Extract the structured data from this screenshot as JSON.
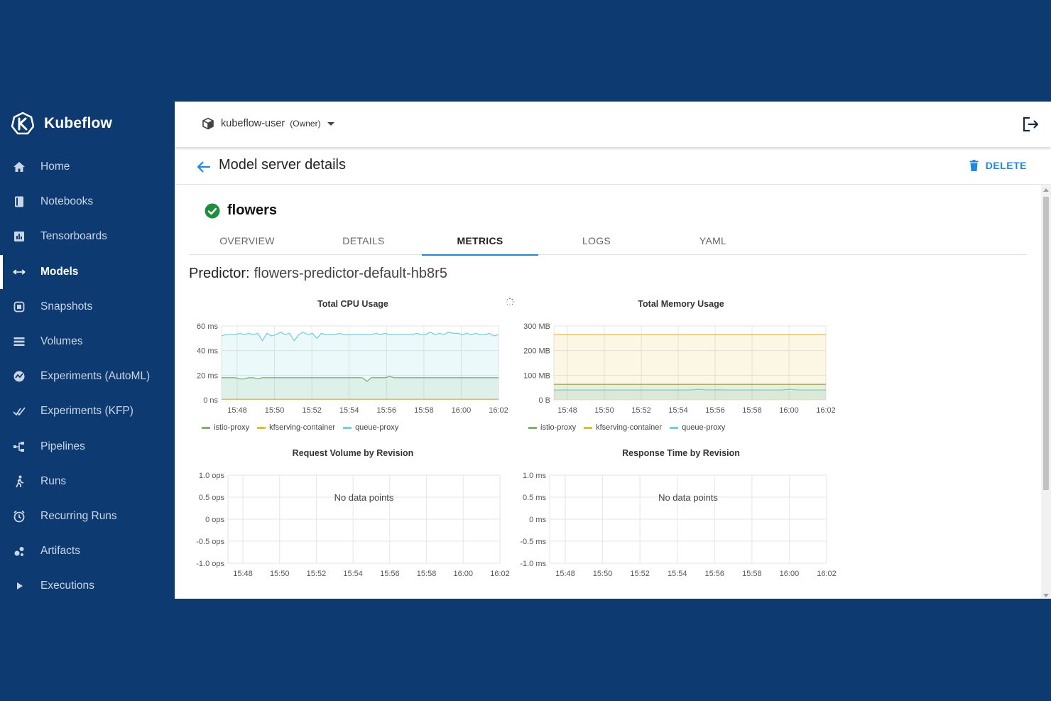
{
  "brand": {
    "name": "Kubeflow"
  },
  "sidebar": {
    "items": [
      {
        "label": "Home",
        "icon": "home-icon",
        "active": false
      },
      {
        "label": "Notebooks",
        "icon": "notebook-icon",
        "active": false
      },
      {
        "label": "Tensorboards",
        "icon": "tensorboard-icon",
        "active": false
      },
      {
        "label": "Models",
        "icon": "models-icon",
        "active": true
      },
      {
        "label": "Snapshots",
        "icon": "snapshot-icon",
        "active": false
      },
      {
        "label": "Volumes",
        "icon": "volumes-icon",
        "active": false
      },
      {
        "label": "Experiments (AutoML)",
        "icon": "automl-icon",
        "active": false
      },
      {
        "label": "Experiments (KFP)",
        "icon": "kfp-icon",
        "active": false
      },
      {
        "label": "Pipelines",
        "icon": "pipelines-icon",
        "active": false
      },
      {
        "label": "Runs",
        "icon": "runs-icon",
        "active": false
      },
      {
        "label": "Recurring Runs",
        "icon": "alarm-icon",
        "active": false
      },
      {
        "label": "Artifacts",
        "icon": "artifacts-icon",
        "active": false
      },
      {
        "label": "Executions",
        "icon": "play-icon",
        "active": false
      }
    ]
  },
  "topbar": {
    "namespace": "kubeflow-user",
    "role": "(Owner)"
  },
  "header": {
    "title": "Model server details",
    "delete_label": "DELETE"
  },
  "server": {
    "name": "flowers",
    "status": "ready"
  },
  "tabs": [
    "OVERVIEW",
    "DETAILS",
    "METRICS",
    "LOGS",
    "YAML"
  ],
  "active_tab": "METRICS",
  "predictor": {
    "label": "Predictor:",
    "value": "flowers-predictor-default-hb8r5"
  },
  "colors": {
    "accent": "#1e88e5",
    "sidebar_bg": "#0d3a70",
    "status_green": "#1e8e3e",
    "istio_proxy": "#7eb26d",
    "kfserving_container": "#eab839",
    "queue_proxy": "#6ed0e0"
  },
  "chart_data": [
    {
      "type": "line",
      "title": "Total CPU Usage",
      "x": [
        "15:48",
        "15:50",
        "15:52",
        "15:54",
        "15:56",
        "15:58",
        "16:00",
        "16:02"
      ],
      "yticks": [
        "60 ms",
        "40 ms",
        "20 ms",
        "0 ns"
      ],
      "ylim": [
        0,
        60
      ],
      "series": [
        {
          "name": "istio-proxy",
          "color": "#7eb26d",
          "values": [
            18,
            18,
            18,
            18,
            17,
            17,
            18,
            18,
            17,
            18,
            18,
            18,
            18,
            18,
            18,
            18,
            18,
            18,
            18,
            18,
            18,
            18,
            18,
            18,
            18,
            18,
            18,
            18,
            18,
            18,
            18,
            18,
            15,
            18,
            18,
            18,
            18,
            19,
            18,
            18,
            18,
            18,
            18,
            18,
            18,
            18,
            18,
            18,
            18,
            18,
            18,
            18,
            18,
            18,
            18,
            18,
            18,
            18,
            18,
            18,
            18,
            18
          ]
        },
        {
          "name": "kfserving-container",
          "color": "#eab839",
          "values": [
            0.5,
            0.5,
            0.5,
            0.5,
            0.5,
            0.5,
            0.5,
            0.5,
            0.5,
            0.5,
            0.5,
            0.5,
            0.5,
            0.5,
            0.5,
            0.5,
            0.5,
            0.5,
            0.5,
            0.5,
            0.5,
            0.5,
            0.5,
            0.5,
            0.5,
            0.5,
            0.5,
            0.5,
            0.5,
            0.5,
            0.5,
            0.5,
            0.5,
            0.5,
            0.5,
            0.5,
            0.5,
            0.5,
            0.5,
            0.5,
            0.5,
            0.5,
            0.5,
            0.5,
            0.5,
            0.5,
            0.5,
            0.5,
            0.5,
            0.5,
            0.5,
            0.5,
            0.5,
            0.5,
            0.5,
            0.5,
            0.5,
            0.5,
            0.5,
            0.5,
            0.5,
            0.5
          ]
        },
        {
          "name": "queue-proxy",
          "color": "#6ed0e0",
          "values": [
            52,
            53,
            53,
            53,
            54,
            53,
            54,
            53,
            54,
            48,
            54,
            52,
            53,
            55,
            53,
            54,
            48,
            53,
            55,
            53,
            54,
            50,
            54,
            53,
            53,
            53,
            54,
            53,
            53,
            53,
            53,
            53,
            53,
            53,
            54,
            53,
            54,
            53,
            53,
            53,
            53,
            53,
            53,
            54,
            53,
            53,
            55,
            53,
            54,
            53,
            55,
            54,
            54,
            53,
            54,
            53,
            54,
            53,
            53,
            54,
            52,
            53
          ]
        }
      ],
      "legend": [
        "istio-proxy",
        "kfserving-container",
        "queue-proxy"
      ],
      "legend_position": "bottom"
    },
    {
      "type": "line",
      "title": "Total Memory Usage",
      "x": [
        "15:48",
        "15:50",
        "15:52",
        "15:54",
        "15:56",
        "15:58",
        "16:00",
        "16:02"
      ],
      "yticks": [
        "300 MB",
        "200 MB",
        "100 MB",
        "0 B"
      ],
      "ylim": [
        0,
        300
      ],
      "series": [
        {
          "name": "istio-proxy",
          "color": "#7eb26d",
          "values": [
            63,
            63,
            63,
            63,
            63,
            63,
            63,
            63,
            63,
            63,
            63,
            63,
            63,
            63,
            63,
            63,
            63,
            63,
            63,
            63,
            63,
            63,
            63,
            63,
            63,
            63,
            63,
            63,
            63,
            63,
            63
          ]
        },
        {
          "name": "kfserving-container",
          "color": "#eab839",
          "values": [
            265,
            265,
            265,
            265,
            265,
            265,
            265,
            265,
            265,
            265,
            265,
            265,
            265,
            265,
            265,
            265,
            265,
            265,
            265,
            265,
            265,
            265,
            265,
            265,
            265,
            265,
            265,
            265,
            265,
            265,
            265
          ]
        },
        {
          "name": "queue-proxy",
          "color": "#6ed0e0",
          "values": [
            40,
            40,
            40,
            40,
            40,
            40,
            40,
            40,
            40,
            40,
            40,
            40,
            40,
            40,
            40,
            40,
            43,
            40,
            41,
            40,
            40,
            40,
            40,
            40,
            40,
            40,
            43,
            40,
            40,
            40,
            40
          ]
        }
      ],
      "legend": [
        "istio-proxy",
        "kfserving-container",
        "queue-proxy"
      ],
      "legend_position": "bottom"
    },
    {
      "type": "line",
      "title": "Request Volume by Revision",
      "x": [
        "15:48",
        "15:50",
        "15:52",
        "15:54",
        "15:56",
        "15:58",
        "16:00",
        "16:02"
      ],
      "yticks": [
        "1.0 ops",
        "0.5 ops",
        "0 ops",
        "-0.5 ops",
        "-1.0 ops"
      ],
      "ylim": [
        -1.0,
        1.0
      ],
      "series": [],
      "annotation": "No data points"
    },
    {
      "type": "line",
      "title": "Response Time by Revision",
      "x": [
        "15:48",
        "15:50",
        "15:52",
        "15:54",
        "15:56",
        "15:58",
        "16:00",
        "16:02"
      ],
      "yticks": [
        "1.0 ms",
        "0.5 ms",
        "0 ms",
        "-0.5 ms",
        "-1.0 ms"
      ],
      "ylim": [
        -1.0,
        1.0
      ],
      "series": [],
      "annotation": "No data points"
    }
  ]
}
